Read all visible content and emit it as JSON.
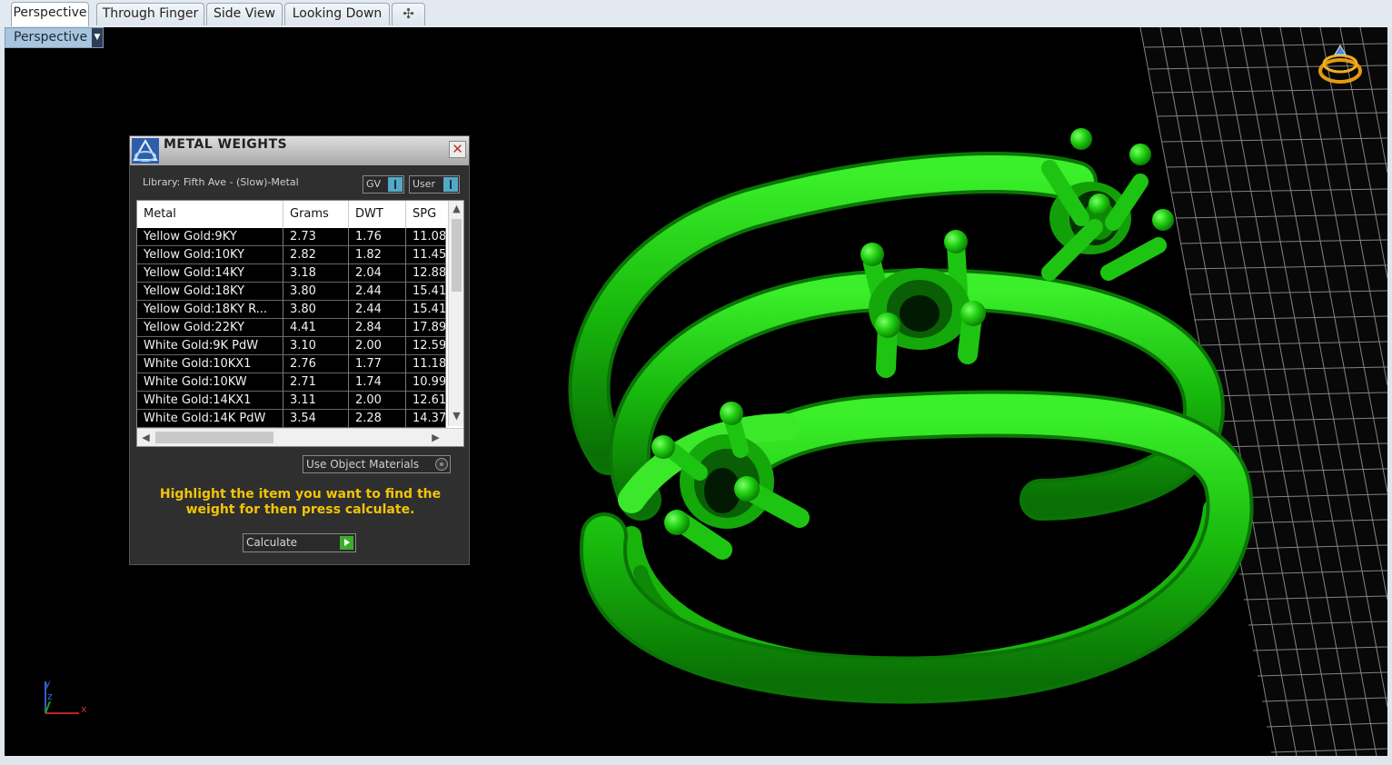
{
  "tabs": [
    {
      "label": "Perspective",
      "active": true
    },
    {
      "label": "Through Finger",
      "active": false
    },
    {
      "label": "Side View",
      "active": false
    },
    {
      "label": "Looking Down",
      "active": false
    }
  ],
  "viewport": {
    "label": "Perspective",
    "axis": {
      "x": "x",
      "y": "y",
      "z": "z"
    }
  },
  "dialog": {
    "title": "METAL WEIGHTS",
    "library": "Library: Fifth Ave - (Slow)-Metal",
    "toggle_gv": "GV",
    "toggle_user": "User",
    "columns": [
      "Metal",
      "Grams",
      "DWT",
      "SPG"
    ],
    "rows": [
      [
        "Yellow Gold:9KY",
        "2.73",
        "1.76",
        "11.08"
      ],
      [
        "Yellow Gold:10KY",
        "2.82",
        "1.82",
        "11.45"
      ],
      [
        "Yellow Gold:14KY",
        "3.18",
        "2.04",
        "12.88"
      ],
      [
        "Yellow Gold:18KY",
        "3.80",
        "2.44",
        "15.41"
      ],
      [
        "Yellow Gold:18KY R...",
        "3.80",
        "2.44",
        "15.41"
      ],
      [
        "Yellow Gold:22KY",
        "4.41",
        "2.84",
        "17.89"
      ],
      [
        "White Gold:9K PdW",
        "3.10",
        "2.00",
        "12.59"
      ],
      [
        "White Gold:10KX1",
        "2.76",
        "1.77",
        "11.18"
      ],
      [
        "White Gold:10KW",
        "2.71",
        "1.74",
        "10.99"
      ],
      [
        "White Gold:14KX1",
        "3.11",
        "2.00",
        "12.61"
      ],
      [
        "White Gold:14K PdW",
        "3.54",
        "2.28",
        "14.37"
      ]
    ],
    "use_object_materials": "Use Object Materials",
    "hint": "Highlight the item you want to find the weight for then press calculate.",
    "calculate": "Calculate"
  },
  "colors": {
    "viewport_bg": "#000000",
    "model_green": "#22cc11",
    "hint_yellow": "#f2c40a",
    "label_bg": "#a9c4de"
  }
}
